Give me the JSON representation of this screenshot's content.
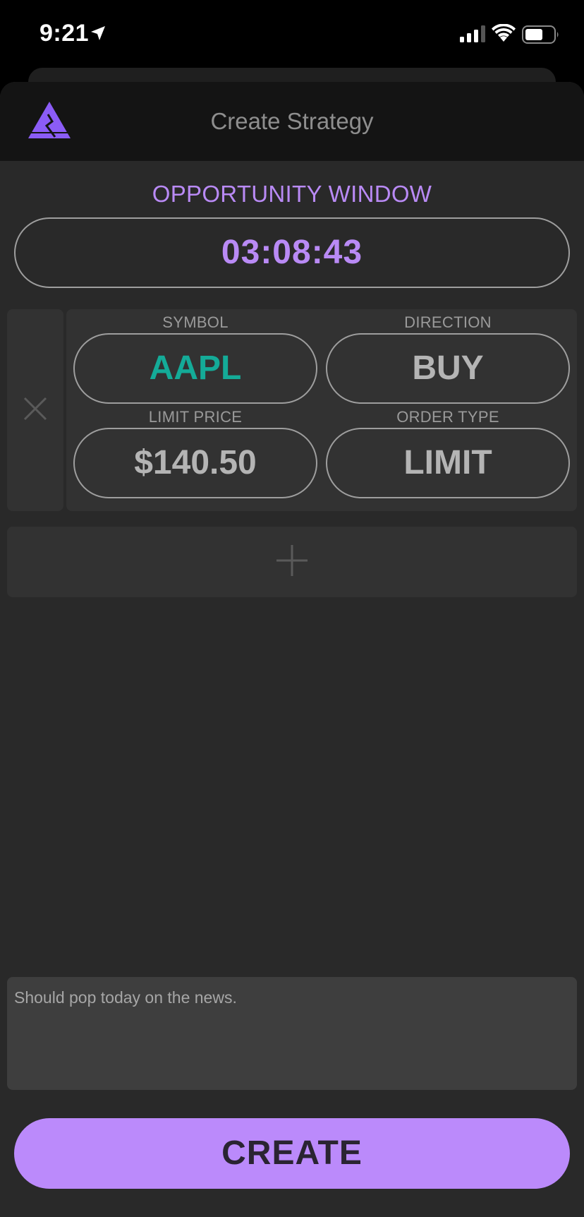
{
  "status_bar": {
    "time": "9:21",
    "location_icon": "location-arrow-icon",
    "signal_icon": "cellular-signal-icon",
    "wifi_icon": "wifi-icon",
    "battery_icon": "battery-icon"
  },
  "header": {
    "title": "Create Strategy",
    "logo_icon": "mountain-logo-icon"
  },
  "opportunity_window": {
    "label": "OPPORTUNITY WINDOW",
    "timer": "03:08:43"
  },
  "leg": {
    "remove_icon": "close-icon",
    "symbol_label": "SYMBOL",
    "symbol_value": "AAPL",
    "direction_label": "DIRECTION",
    "direction_value": "BUY",
    "limit_price_label": "LIMIT PRICE",
    "limit_price_value": "$140.50",
    "order_type_label": "ORDER TYPE",
    "order_type_value": "LIMIT"
  },
  "add_leg_icon": "plus-icon",
  "note": {
    "text": "Should pop today on the news."
  },
  "create_button": {
    "label": "CREATE"
  },
  "colors": {
    "accent_purple": "#bb8afb",
    "symbol_teal": "#14ab98",
    "background": "#292929",
    "header_bg": "#141414"
  }
}
